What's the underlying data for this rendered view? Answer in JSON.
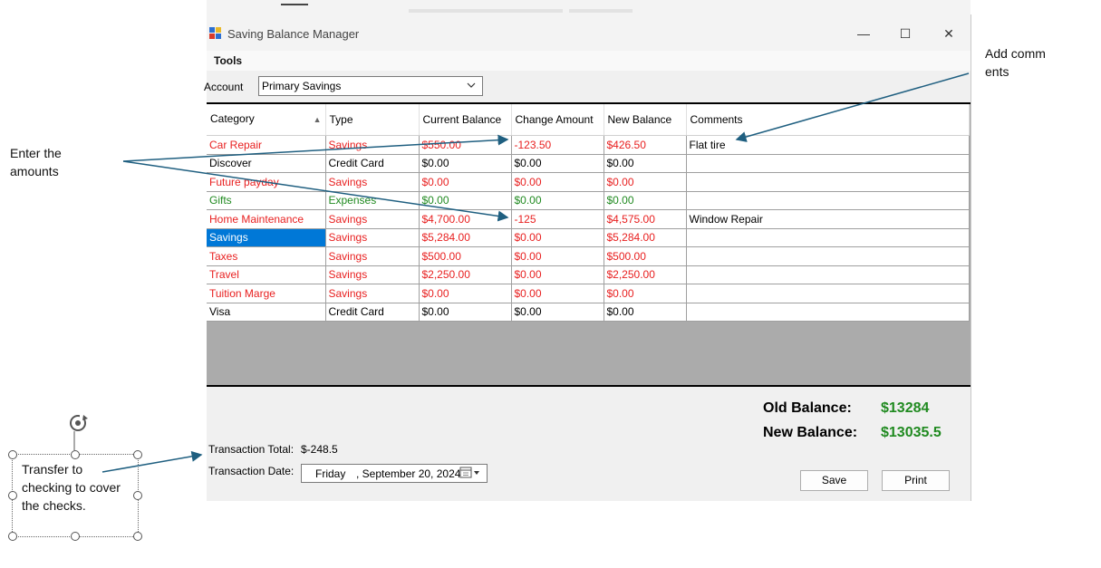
{
  "window": {
    "title": "Saving Balance Manager",
    "menu": [
      "Tools"
    ]
  },
  "account": {
    "label": "Account",
    "selected": "Primary Savings"
  },
  "grid": {
    "columns": [
      "Category",
      "Type",
      "Current Balance",
      "Change Amount",
      "New Balance",
      "Comments"
    ],
    "rows": [
      {
        "category": "Car Repair",
        "type": "Savings",
        "current": "$550.00",
        "change": "-123.50",
        "new": "$426.50",
        "comments": "Flat tire",
        "color": "#e81f1f"
      },
      {
        "category": "Discover",
        "type": "Credit Card",
        "current": "$0.00",
        "change": "$0.00",
        "new": "$0.00",
        "comments": "",
        "color": "#000000"
      },
      {
        "category": "Future payday",
        "type": "Savings",
        "current": "$0.00",
        "change": "$0.00",
        "new": "$0.00",
        "comments": "",
        "color": "#e81f1f"
      },
      {
        "category": "Gifts",
        "type": "Expenses",
        "current": "$0.00",
        "change": "$0.00",
        "new": "$0.00",
        "comments": "",
        "color": "#208a20"
      },
      {
        "category": "Home Maintenance",
        "type": "Savings",
        "current": "$4,700.00",
        "change": "-125",
        "new": "$4,575.00",
        "comments": "Window Repair",
        "color": "#e81f1f"
      },
      {
        "category": "Savings",
        "type": "Savings",
        "current": "$5,284.00",
        "change": "$0.00",
        "new": "$5,284.00",
        "comments": "",
        "color": "#e81f1f"
      },
      {
        "category": "Taxes",
        "type": "Savings",
        "current": "$500.00",
        "change": "$0.00",
        "new": "$500.00",
        "comments": "",
        "color": "#e81f1f"
      },
      {
        "category": "Travel",
        "type": "Savings",
        "current": "$2,250.00",
        "change": "$0.00",
        "new": "$2,250.00",
        "comments": "",
        "color": "#e81f1f"
      },
      {
        "category": "Tuition Marge",
        "type": "Savings",
        "current": "$0.00",
        "change": "$0.00",
        "new": "$0.00",
        "comments": "",
        "color": "#e81f1f"
      },
      {
        "category": "Visa",
        "type": "Credit Card",
        "current": "$0.00",
        "change": "$0.00",
        "new": "$0.00",
        "comments": "",
        "color": "#000000"
      }
    ]
  },
  "footer": {
    "transaction_total_label": "Transaction Total:",
    "transaction_total": "$-248.5",
    "transaction_date_label": "Transaction Date:",
    "date_day": "Friday",
    "date_rest": ", September 20, 2024",
    "old_balance_label": "Old Balance:",
    "old_balance": "$13284",
    "new_balance_label": "New Balance:",
    "new_balance": "$13035.5",
    "save_label": "Save",
    "print_label": "Print"
  },
  "annotations": {
    "enter_amounts": "Enter the amounts",
    "add_comments": "Add comments",
    "transfer": "Transfer to checking to cover the checks."
  },
  "colors": {
    "selection": "#0078d7",
    "positive": "#208a20",
    "savings": "#e81f1f"
  }
}
